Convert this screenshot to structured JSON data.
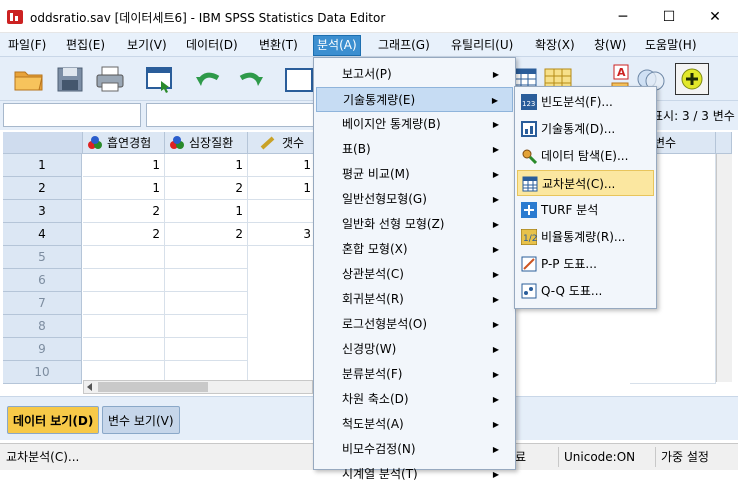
{
  "window": {
    "title": "oddsratio.sav [데이터세트6] - IBM SPSS Statistics Data Editor",
    "minimize_glyph": "─",
    "maximize_glyph": "☐",
    "close_glyph": "✕"
  },
  "menubar": [
    {
      "label": "파일(F)"
    },
    {
      "label": "편집(E)"
    },
    {
      "label": "보기(V)"
    },
    {
      "label": "데이터(D)"
    },
    {
      "label": "변환(T)"
    },
    {
      "label": "분석(A)"
    },
    {
      "label": "그래프(G)"
    },
    {
      "label": "유틸리티(U)"
    },
    {
      "label": "확장(X)"
    },
    {
      "label": "창(W)"
    },
    {
      "label": "도움말(H)"
    }
  ],
  "toolbar": {
    "icons": [
      "open-folder-icon",
      "save-icon",
      "print-icon",
      "recall-dialog-icon",
      "undo-icon",
      "redo-icon",
      "goto-case-icon",
      "variables-icon",
      "select-cases-icon",
      "value-labels-icon",
      "use-sets-icon",
      "add-icon"
    ]
  },
  "visible_label": "표시: 3 / 3 변수",
  "grid": {
    "columns": [
      "흡연경험",
      "심장질환",
      "갯수",
      "변수"
    ],
    "rows": [
      {
        "n": "1",
        "values": [
          "1",
          "1",
          "1"
        ]
      },
      {
        "n": "2",
        "values": [
          "1",
          "2",
          "1"
        ]
      },
      {
        "n": "3",
        "values": [
          "2",
          "1",
          ""
        ]
      },
      {
        "n": "4",
        "values": [
          "2",
          "2",
          "3"
        ]
      },
      {
        "n": "5",
        "values": [
          "",
          "",
          ""
        ]
      },
      {
        "n": "6",
        "values": [
          "",
          "",
          ""
        ]
      },
      {
        "n": "7",
        "values": [
          "",
          "",
          ""
        ]
      },
      {
        "n": "8",
        "values": [
          "",
          "",
          ""
        ]
      },
      {
        "n": "9",
        "values": [
          "",
          "",
          ""
        ]
      },
      {
        "n": "10",
        "values": [
          "",
          "",
          ""
        ]
      }
    ]
  },
  "tabs": {
    "data_view": "데이터 보기(D)",
    "variable_view": "변수 보기(V)"
  },
  "statusbar": {
    "left": "교차분석(C)...",
    "middle": "료",
    "unicode": "Unicode:ON",
    "weight": "가중 설정"
  },
  "analyze_menu": [
    {
      "label": "보고서(P)",
      "has_sub": true
    },
    {
      "label": "기술통계량(E)",
      "has_sub": true,
      "selected": true
    },
    {
      "label": "베이지안 통계량(B)",
      "has_sub": true
    },
    {
      "label": "표(B)",
      "has_sub": true
    },
    {
      "label": "평균 비교(M)",
      "has_sub": true
    },
    {
      "label": "일반선형모형(G)",
      "has_sub": true
    },
    {
      "label": "일반화 선형 모형(Z)",
      "has_sub": true
    },
    {
      "label": "혼합 모형(X)",
      "has_sub": true
    },
    {
      "label": "상관분석(C)",
      "has_sub": true
    },
    {
      "label": "회귀분석(R)",
      "has_sub": true
    },
    {
      "label": "로그선형분석(O)",
      "has_sub": true
    },
    {
      "label": "신경망(W)",
      "has_sub": true
    },
    {
      "label": "분류분석(F)",
      "has_sub": true
    },
    {
      "label": "차원 축소(D)",
      "has_sub": true
    },
    {
      "label": "척도분석(A)",
      "has_sub": true
    },
    {
      "label": "비모수검정(N)",
      "has_sub": true
    },
    {
      "label": "시계열 분석(T)",
      "has_sub": true
    }
  ],
  "descriptives_submenu": [
    {
      "label": "빈도분석(F)...",
      "icon": "frequencies-icon"
    },
    {
      "label": "기술통계(D)...",
      "icon": "descriptives-icon"
    },
    {
      "label": "데이터 탐색(E)...",
      "icon": "explore-icon"
    },
    {
      "label": "교차분석(C)...",
      "icon": "crosstabs-icon",
      "selected": true
    },
    {
      "label": "TURF 분석",
      "icon": "turf-icon"
    },
    {
      "label": "비율통계량(R)...",
      "icon": "ratio-icon"
    },
    {
      "label": "P-P 도표...",
      "icon": "pp-plot-icon"
    },
    {
      "label": "Q-Q 도표...",
      "icon": "qq-plot-icon"
    }
  ],
  "colors": {
    "accent": "#3c8fd0",
    "data_tab": "#f7c948",
    "highlight": "#fbe7a0"
  }
}
